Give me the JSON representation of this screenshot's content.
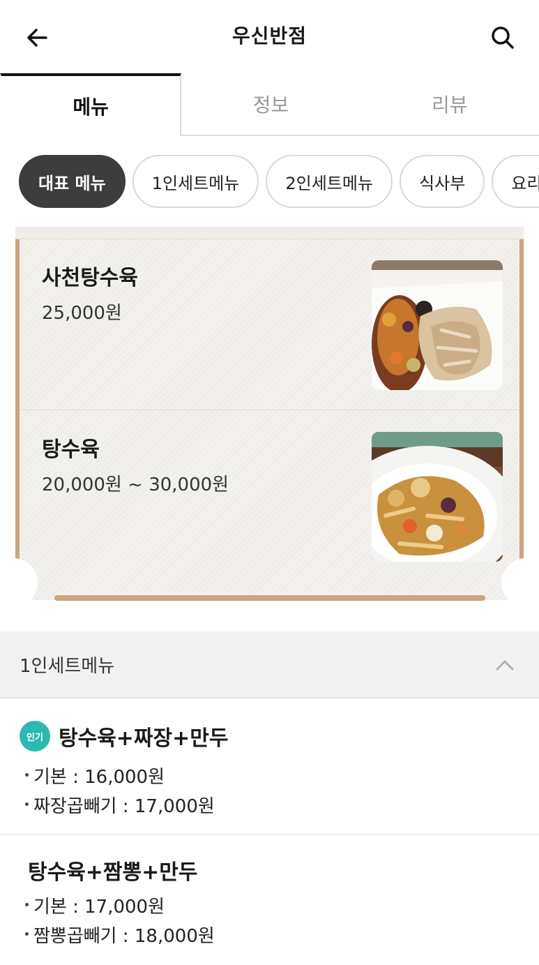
{
  "header": {
    "title": "우신반점",
    "back_icon": "arrow-left-icon",
    "search_icon": "search-icon"
  },
  "tabs": [
    {
      "label": "메뉴",
      "active": true
    },
    {
      "label": "정보",
      "active": false
    },
    {
      "label": "리뷰",
      "active": false
    }
  ],
  "chips": [
    {
      "label": "대표 메뉴",
      "active": true
    },
    {
      "label": "1인세트메뉴",
      "active": false
    },
    {
      "label": "2인세트메뉴",
      "active": false
    },
    {
      "label": "식사부",
      "active": false
    },
    {
      "label": "요리부",
      "active": false
    }
  ],
  "featured": {
    "items": [
      {
        "name": "사천탕수육",
        "price": "25,000원",
        "image": "sichuan-tangsuyuk-photo"
      },
      {
        "name": "탕수육",
        "price": "20,000원 ~ 30,000원",
        "image": "tangsuyuk-photo"
      }
    ]
  },
  "section": {
    "title": "1인세트메뉴",
    "toggle_icon": "chevron-up-icon"
  },
  "set_menu": [
    {
      "badge": "인기",
      "name": "탕수육+짜장+만두",
      "options": [
        "기본 : 16,000원",
        "짜장곱빼기 : 17,000원"
      ]
    },
    {
      "badge": "",
      "name": "탕수육+짬뽕+만두",
      "options": [
        "기본 : 17,000원",
        "짬뽕곱빼기 : 18,000원"
      ]
    }
  ],
  "colors": {
    "accent_brown": "#c8a681",
    "badge_teal": "#2bbab0",
    "chip_active": "#3d3d3d"
  }
}
